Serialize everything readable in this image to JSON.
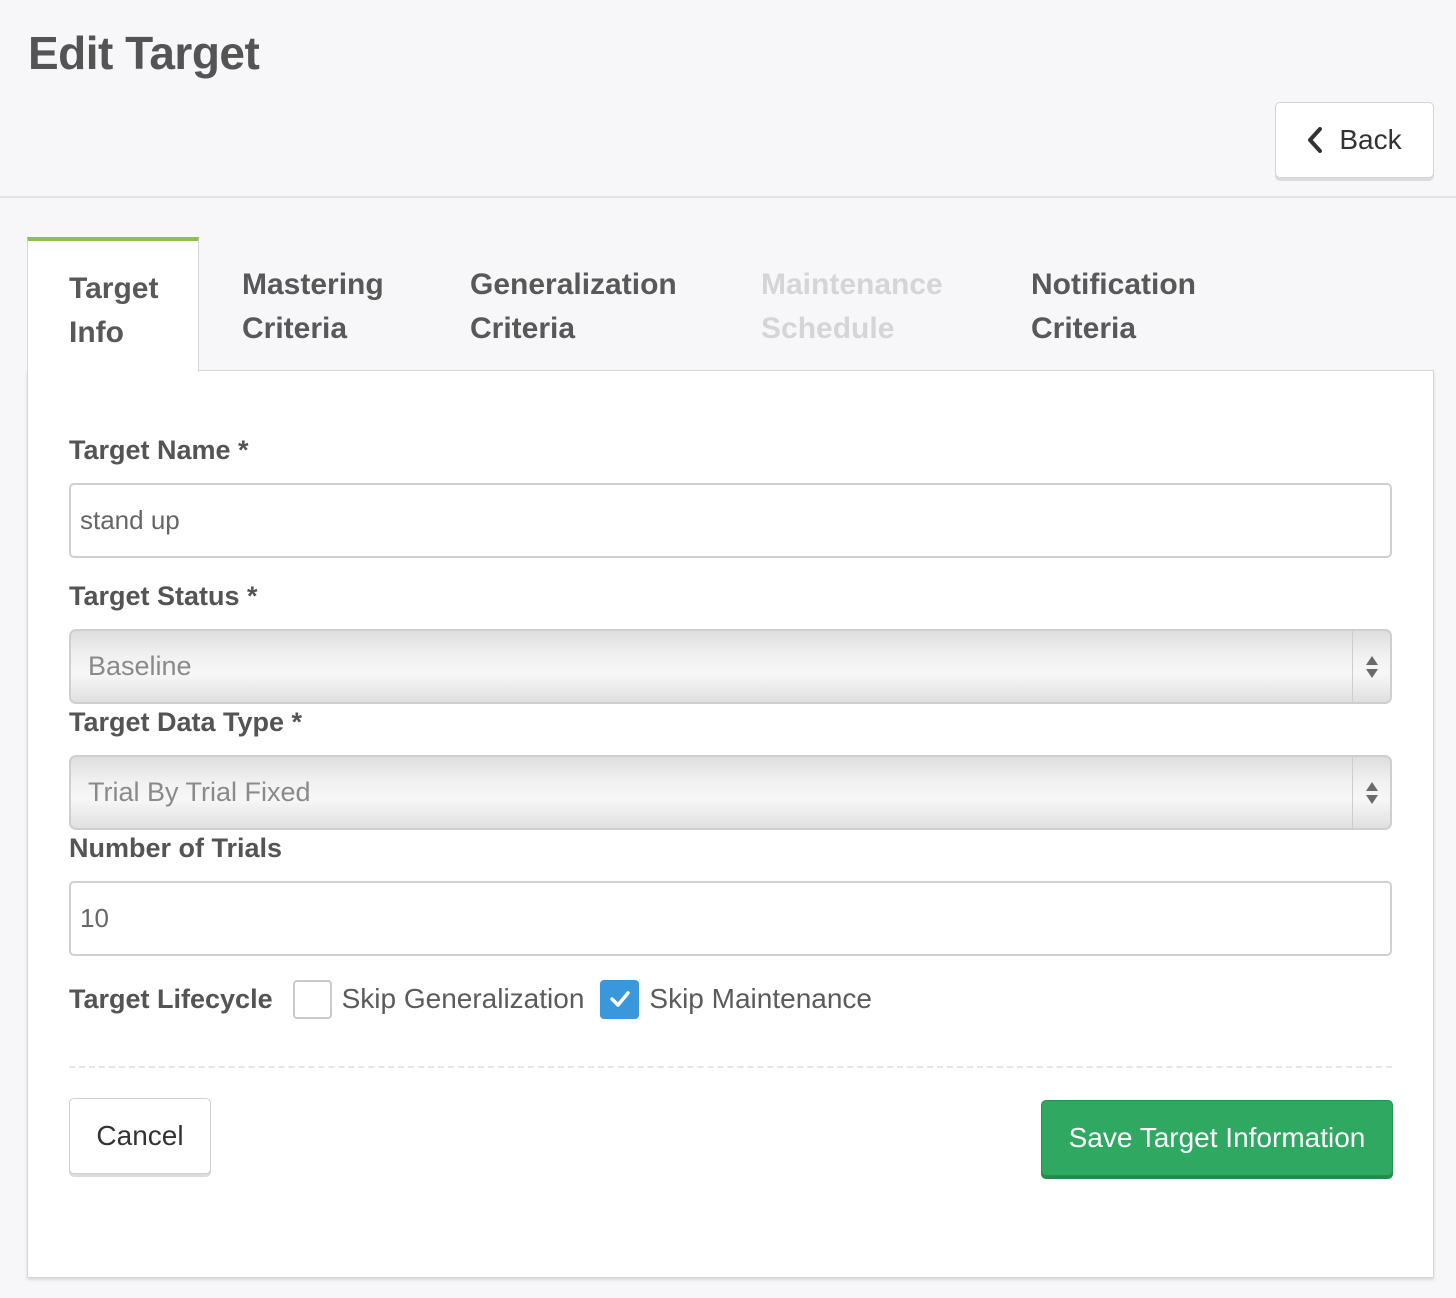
{
  "header": {
    "title": "Edit Target",
    "back_label": "Back"
  },
  "tabs": [
    {
      "line1": "Target",
      "line2": "Info",
      "active": true,
      "disabled": false
    },
    {
      "line1": "Mastering",
      "line2": "Criteria",
      "active": false,
      "disabled": false
    },
    {
      "line1": "Generalization",
      "line2": "Criteria",
      "active": false,
      "disabled": false
    },
    {
      "line1": "Maintenance",
      "line2": "Schedule",
      "active": false,
      "disabled": true
    },
    {
      "line1": "Notification",
      "line2": "Criteria",
      "active": false,
      "disabled": false
    }
  ],
  "form": {
    "target_name": {
      "label": "Target Name *",
      "value": "stand up"
    },
    "target_status": {
      "label": "Target Status *",
      "value": "Baseline"
    },
    "target_data_type": {
      "label": "Target Data Type *",
      "value": "Trial By Trial Fixed"
    },
    "number_of_trials": {
      "label": "Number of Trials",
      "value": "10"
    },
    "lifecycle": {
      "label": "Target Lifecycle",
      "skip_generalization": {
        "label": "Skip Generalization",
        "checked": false
      },
      "skip_maintenance": {
        "label": "Skip Maintenance",
        "checked": true
      }
    }
  },
  "actions": {
    "cancel_label": "Cancel",
    "save_label": "Save Target Information"
  },
  "colors": {
    "accent_tab": "#8bc34a",
    "save_button": "#2fa862",
    "checkbox_checked": "#3a97dc",
    "disabled_tab_text": "#d5d5d8"
  },
  "icons": {
    "back": "chevron-left-icon",
    "select_arrows": "sort-arrows-icon",
    "checkmark": "check-icon"
  }
}
